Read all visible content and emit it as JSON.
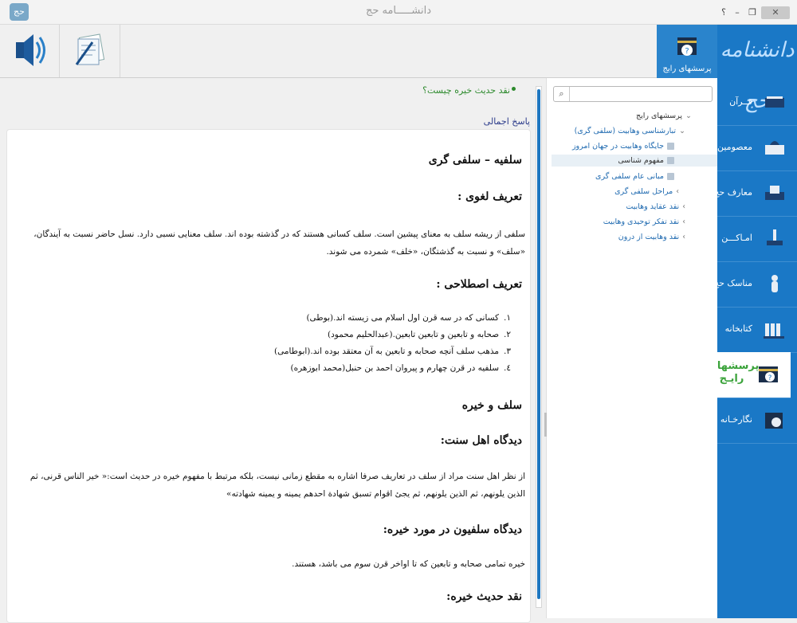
{
  "window": {
    "title": "دانشـــــامه حج",
    "help_label": "؟",
    "logo_label": "حج"
  },
  "toolbar": {
    "faq_label": "پرسشهای رایج"
  },
  "sidebar": {
    "brand": "دانشنامه حج",
    "items": [
      {
        "label": "قــرآن"
      },
      {
        "label": "معصومین"
      },
      {
        "label": "معارف حج"
      },
      {
        "label": "امـاکـــن"
      },
      {
        "label": "مناسک حج"
      },
      {
        "label": "کتابخانه"
      },
      {
        "label": "پرسشهای رایـج"
      },
      {
        "label": "نگارخـانه"
      }
    ]
  },
  "tree": {
    "search_placeholder": "",
    "nodes": [
      {
        "label": "پرسشهای رایج",
        "arrow": "⌄"
      },
      {
        "label": "تبارشناسی وهابیت (سلفی گری)",
        "arrow": "⌄"
      },
      {
        "label": "جایگاه وهابیت در جهان امروز"
      },
      {
        "label": "مفهوم شناسی"
      },
      {
        "label": "مبانی عام سلفی گری"
      },
      {
        "label": "مراحل سلفی گری",
        "arrow": "›"
      },
      {
        "label": "نقد عقاید وهابیت",
        "arrow": "›"
      },
      {
        "label": "نقد تفکر توحیدی وهابیت",
        "arrow": "›"
      },
      {
        "label": "نقد وهابیت از درون",
        "arrow": "›"
      }
    ]
  },
  "content": {
    "question": "نقد حدیث خیره چیست؟",
    "brief_label": "پاسخ اجمالی",
    "h1": "سلفیه – سلفی گری",
    "h_lexical": "تعریف لغوی :",
    "p_lexical": "سلفی از ریشه سلف به معنای پیشین است. سلف کسانی هستند که در گذشته بوده اند. سلف معنایی نسبی دارد. نسل حاضر نسبت به آیندگان، «سلف» و نسبت به گذشتگان، «خلف» شمرده می شوند.",
    "h_term": "تعریف اصطلاحی :",
    "list": [
      {
        "n": "۱.",
        "t": "کسانی که در سه قرن اول اسلام می زیسته اند.(بوطی)"
      },
      {
        "n": "۲.",
        "t": "صحابه و تابعین و تابعین تابعین.(عبدالحلیم محمود)"
      },
      {
        "n": "۳.",
        "t": "مذهب سلف آنچه صحابه و تابعین به آن معتقد بوده اند.(ابوطامی)"
      },
      {
        "n": "٤.",
        "t": "سلفیه در قرن چهارم و پیروان احمد بن حنبل(محمد ابوزهره)"
      }
    ],
    "h_salaf": "سلف و خیره",
    "h_sunni": "دیدگاه اهل سنت:",
    "p_sunni": "از نظر اهل سنت مراد از سلف در تعاریف صرفا اشاره به مقطع زمانی نیست، بلکه مرتبط با مفهوم خیره در حدیث است:« خیر الناس قرنی، ثم الذین یلونهم، ثم الذین یلونهم، ثم یجئ اقوام تسبق شهادة احدهم یمینه و یمینه شهادته»",
    "h_salafi": "دیدگاه سلفیون در مورد خیره:",
    "p_salafi": "خیره تمامی صحابه و تابعین که تا اواخر قرن سوم می باشد، هستند.",
    "h_critique": "نقد حدیث خیره:"
  }
}
